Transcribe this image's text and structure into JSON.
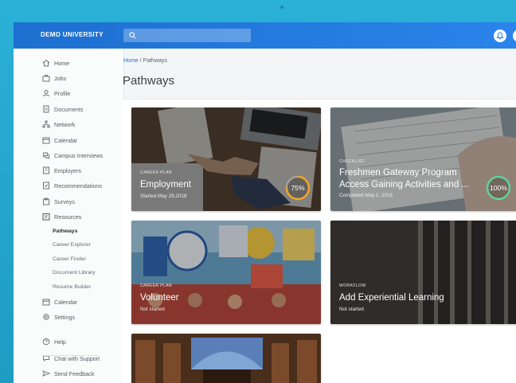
{
  "brand": "DEMO UNIVERSITY",
  "nav": [
    {
      "label": "Home",
      "icon": "home-icon"
    },
    {
      "label": "Jobs",
      "icon": "briefcase-icon"
    },
    {
      "label": "Profile",
      "icon": "user-icon"
    },
    {
      "label": "Documents",
      "icon": "document-icon"
    },
    {
      "label": "Network",
      "icon": "network-icon"
    },
    {
      "label": "Calendar",
      "icon": "calendar-icon"
    },
    {
      "label": "Campus Interviews",
      "icon": "interview-icon"
    },
    {
      "label": "Employers",
      "icon": "building-icon"
    },
    {
      "label": "Recommendations",
      "icon": "recommendation-icon"
    },
    {
      "label": "Surveys",
      "icon": "survey-icon"
    },
    {
      "label": "Resources",
      "icon": "resources-icon"
    }
  ],
  "resources_sub": [
    "Pathways",
    "Career Explorer",
    "Career Finder",
    "Document Library",
    "Resume Builder"
  ],
  "nav_after": [
    {
      "label": "Calendar",
      "icon": "calendar-icon"
    },
    {
      "label": "Settings",
      "icon": "settings-icon"
    }
  ],
  "nav_footer": [
    {
      "label": "Help",
      "icon": "help-icon"
    },
    {
      "label": "Chat with Support",
      "icon": "chat-icon"
    },
    {
      "label": "Send Feedback",
      "icon": "send-icon"
    }
  ],
  "breadcrumb": {
    "home": "Home",
    "sep": "/",
    "current": "Pathways"
  },
  "page_title": "Pathways",
  "cards": [
    {
      "kicker": "CAREER PLAN",
      "title": "Employment",
      "meta": "Started May 29,2018",
      "progress": "75%",
      "progress_value": 0.75,
      "ring_color": "#f5a623"
    },
    {
      "kicker": "CHECKLIST",
      "title": "Freshmen Gateway Program",
      "title2": "Access Gaining Activities and ...",
      "meta": "Completed May 2, 2018",
      "progress": "100%",
      "progress_value": 1.0,
      "ring_color": "#5fd39a"
    },
    {
      "kicker": "CAREER PLAN",
      "title": "Volunteer",
      "meta": "Not started"
    },
    {
      "kicker": "WORKFLOW",
      "title": "Add Experiential Learning",
      "meta": "Not started"
    }
  ]
}
